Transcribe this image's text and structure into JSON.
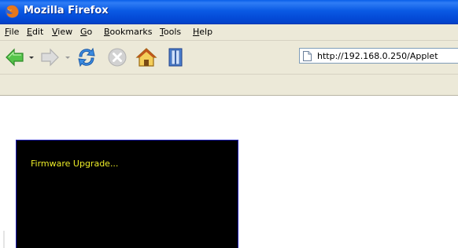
{
  "window": {
    "title": "Mozilla Firefox",
    "icon": "firefox-logo-icon",
    "title_bar_color": "#0a5ae4"
  },
  "menu": {
    "items": [
      {
        "label": "File"
      },
      {
        "label": "Edit"
      },
      {
        "label": "View"
      },
      {
        "label": "Go"
      },
      {
        "label": "Bookmarks"
      },
      {
        "label": "Tools"
      },
      {
        "label": "Help"
      }
    ]
  },
  "navigation": {
    "buttons": [
      {
        "name": "back",
        "icon": "back-arrow-icon",
        "enabled": true,
        "color": "#3fb43a"
      },
      {
        "name": "forward",
        "icon": "forward-arrow-icon",
        "enabled": false
      },
      {
        "name": "reload",
        "icon": "reload-icon",
        "enabled": true,
        "color": "#2f7fd8"
      },
      {
        "name": "stop",
        "icon": "stop-icon",
        "enabled": false
      },
      {
        "name": "home",
        "icon": "home-icon",
        "enabled": true
      },
      {
        "name": "bookmarks",
        "icon": "bookmarks-sidebar-icon",
        "enabled": true
      }
    ],
    "address": {
      "url": "http://192.168.0.250/Applet",
      "icon": "page-icon"
    }
  },
  "content": {
    "applet": {
      "status_text": "Firmware Upgrade...",
      "background_color": "#000000",
      "text_color": "#ecec28"
    }
  }
}
